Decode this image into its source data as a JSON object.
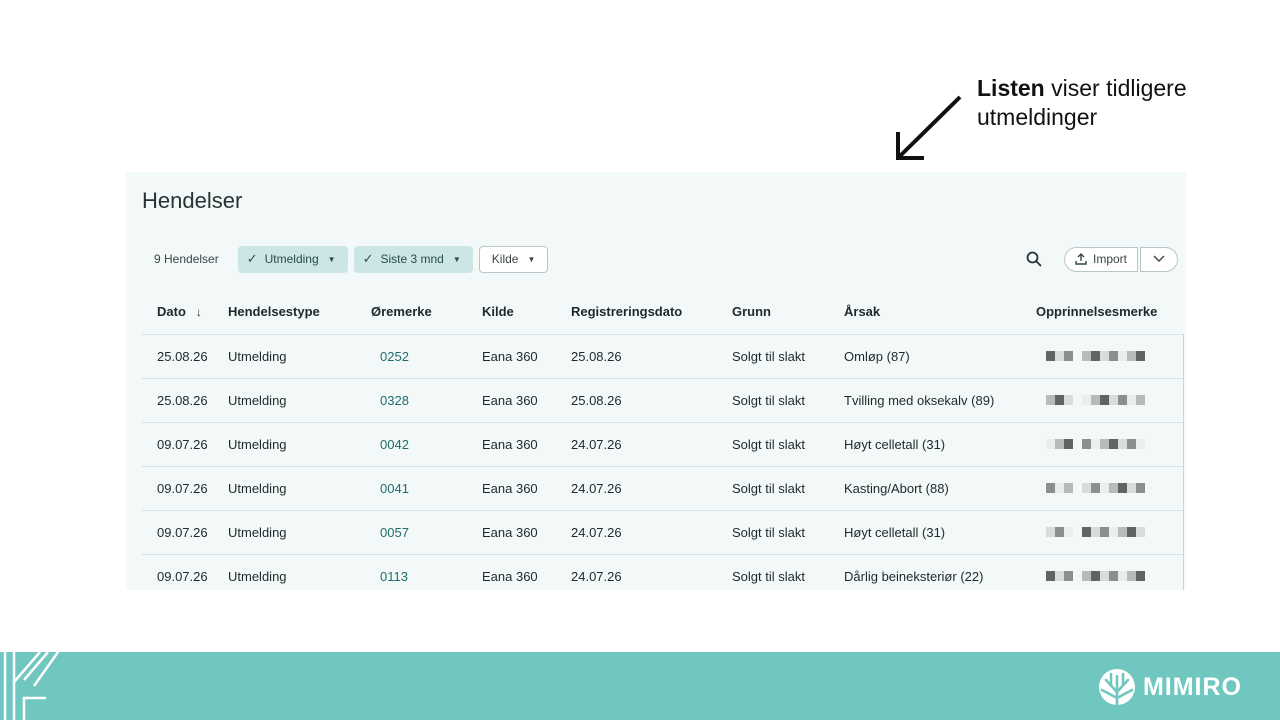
{
  "annotation": {
    "bold": "Listen",
    "rest": " viser tidligere utmeldinger"
  },
  "panel": {
    "title": "Hendelser"
  },
  "toolbar": {
    "count": "9 Hendelser",
    "filters": [
      {
        "label": "Utmelding",
        "active": true
      },
      {
        "label": "Siste 3 mnd",
        "active": true
      },
      {
        "label": "Kilde",
        "active": false
      }
    ],
    "import_label": "Import"
  },
  "table": {
    "headers": [
      "Dato",
      "Hendelsestype",
      "Øremerke",
      "Kilde",
      "Registreringsdato",
      "Grunn",
      "Årsak",
      "Opprinnelsesmerke"
    ],
    "rows": [
      {
        "dato": "25.08.26",
        "type": "Utmelding",
        "ear": "0252",
        "kilde": "Eana 360",
        "reg": "25.08.26",
        "grunn": "Solgt til slakt",
        "arsak": "Omløp (87)"
      },
      {
        "dato": "25.08.26",
        "type": "Utmelding",
        "ear": "0328",
        "kilde": "Eana 360",
        "reg": "25.08.26",
        "grunn": "Solgt til slakt",
        "arsak": "Tvilling med oksekalv (89)"
      },
      {
        "dato": "09.07.26",
        "type": "Utmelding",
        "ear": "0042",
        "kilde": "Eana 360",
        "reg": "24.07.26",
        "grunn": "Solgt til slakt",
        "arsak": "Høyt celletall (31)"
      },
      {
        "dato": "09.07.26",
        "type": "Utmelding",
        "ear": "0041",
        "kilde": "Eana 360",
        "reg": "24.07.26",
        "grunn": "Solgt til slakt",
        "arsak": "Kasting/Abort (88)"
      },
      {
        "dato": "09.07.26",
        "type": "Utmelding",
        "ear": "0057",
        "kilde": "Eana 360",
        "reg": "24.07.26",
        "grunn": "Solgt til slakt",
        "arsak": "Høyt celletall (31)"
      },
      {
        "dato": "09.07.26",
        "type": "Utmelding",
        "ear": "0113",
        "kilde": "Eana 360",
        "reg": "24.07.26",
        "grunn": "Solgt til slakt",
        "arsak": "Dårlig beineksteriør (22)"
      }
    ]
  },
  "brand": {
    "name": "MIMIRO",
    "color": "#6fc7bf",
    "accent": "#1d6e6e"
  }
}
